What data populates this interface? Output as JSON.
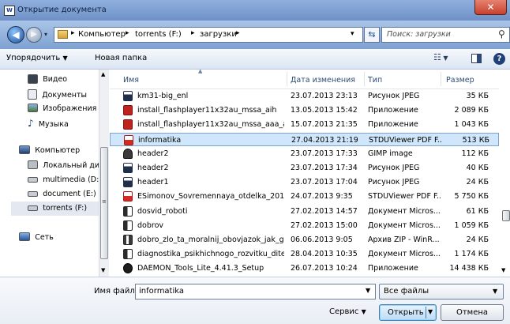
{
  "window": {
    "title": "Открытие документа"
  },
  "nav": {
    "breadcrumb": [
      "Компьютер",
      "torrents (F:)",
      "загрузки"
    ],
    "search_placeholder": "Поиск: загрузки"
  },
  "toolbar": {
    "organize": "Упорядочить",
    "new_folder": "Новая папка"
  },
  "sidebar": {
    "items": [
      "Видео",
      "Документы",
      "Изображения",
      "Музыка",
      "Компьютер",
      "Локальный диск",
      "multimedia (D:)",
      "document (E:)",
      "torrents (F:)",
      "Сеть"
    ]
  },
  "columns": {
    "name": "Имя",
    "date": "Дата изменения",
    "type": "Тип",
    "size": "Размер"
  },
  "files": [
    {
      "name": "km31-big_enl",
      "date": "23.07.2013 23:13",
      "type": "Рисунок JPEG",
      "size": "35 КБ",
      "icon": "image-file-icon"
    },
    {
      "name": "install_flashplayer11x32au_mssa_aih",
      "date": "13.05.2013 15:42",
      "type": "Приложение",
      "size": "2 089 КБ",
      "icon": "flash-installer-icon"
    },
    {
      "name": "install_flashplayer11x32au_mssa_aaa_aih",
      "date": "15.07.2013 21:35",
      "type": "Приложение",
      "size": "1 043 КБ",
      "icon": "flash-installer-icon"
    },
    {
      "name": "informatika",
      "date": "27.04.2013 21:19",
      "type": "STDUViewer PDF F...",
      "size": "513 КБ",
      "icon": "pdf-file-icon"
    },
    {
      "name": "header2",
      "date": "23.07.2013 17:33",
      "type": "GIMP image",
      "size": "112 КБ",
      "icon": "gimp-file-icon"
    },
    {
      "name": "header2",
      "date": "23.07.2013 17:34",
      "type": "Рисунок JPEG",
      "size": "40 КБ",
      "icon": "image-file-icon"
    },
    {
      "name": "header1",
      "date": "23.07.2013 17:04",
      "type": "Рисунок JPEG",
      "size": "24 КБ",
      "icon": "image-file-icon"
    },
    {
      "name": "ESimonov_Sovremennaya_otdelka_2010",
      "date": "24.07.2013 9:35",
      "type": "STDUViewer PDF F...",
      "size": "5 750 КБ",
      "icon": "pdf-file-icon"
    },
    {
      "name": "dosvid_roboti",
      "date": "27.02.2013 14:57",
      "type": "Документ Micros...",
      "size": "61 КБ",
      "icon": "word-file-icon"
    },
    {
      "name": "dobrov",
      "date": "27.02.2013 15:00",
      "type": "Документ Micros...",
      "size": "1 059 КБ",
      "icon": "word-file-icon"
    },
    {
      "name": "dobro_zlo_ta_moralnij_obovjazok_jak_gol...",
      "date": "06.06.2013 9:05",
      "type": "Архив ZIP - WinR...",
      "size": "24 КБ",
      "icon": "zip-file-icon"
    },
    {
      "name": "diagnostika_psikhichnogo_rozvitku_ditey...",
      "date": "28.04.2013 10:35",
      "type": "Документ Micros...",
      "size": "1 174 КБ",
      "icon": "word-file-icon"
    },
    {
      "name": "DAEMON_Tools_Lite_4.41.3_Setup",
      "date": "26.07.2013 10:24",
      "type": "Приложение",
      "size": "14 438 КБ",
      "icon": "daemon-tools-icon"
    }
  ],
  "selected_index": 3,
  "footer": {
    "filename_label": "Имя файла:",
    "filename_value": "informatika",
    "filter_value": "Все файлы",
    "service": "Сервис",
    "open": "Открыть",
    "cancel": "Отмена"
  },
  "colors": {
    "selection_fill": "#cfe6fb",
    "selection_border": "#7da2ce",
    "close_button": "#c7402e",
    "titlebar": "#6f90c7"
  }
}
